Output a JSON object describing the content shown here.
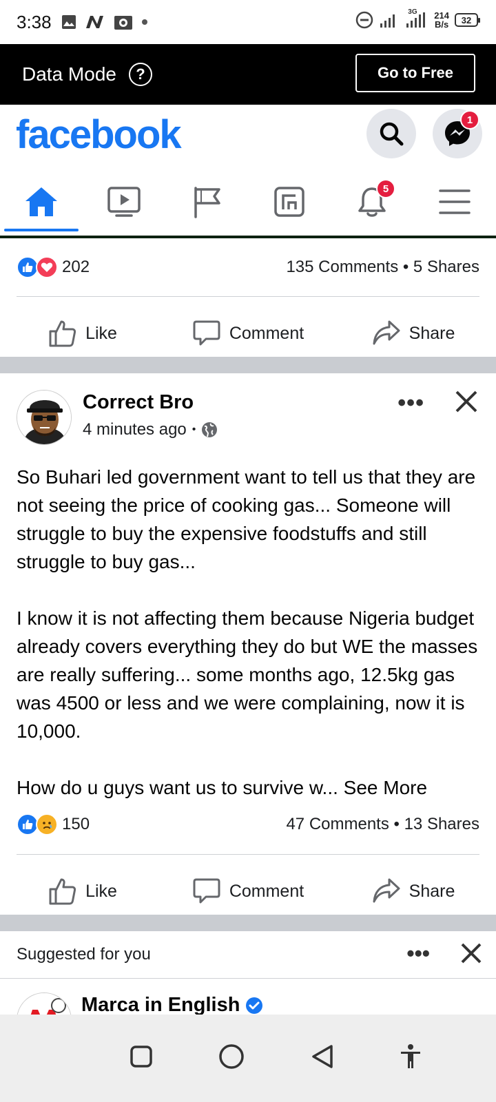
{
  "status_bar": {
    "time": "3:38",
    "network_type": "3G",
    "net_speed_value": "214",
    "net_speed_unit": "B/s",
    "battery": "32"
  },
  "data_mode": {
    "label": "Data Mode",
    "help": "?",
    "go_free_label": "Go to Free"
  },
  "header": {
    "logo": "facebook",
    "messenger_badge": "1"
  },
  "nav": {
    "notifications_badge": "5",
    "active_tab": "home"
  },
  "post1": {
    "reaction_count": "202",
    "comments_shares": "135 Comments • 5 Shares",
    "like_label": "Like",
    "comment_label": "Comment",
    "share_label": "Share"
  },
  "post2": {
    "author": "Correct Bro",
    "time": "4 minutes ago",
    "dot": "•",
    "paragraphs": [
      "So Buhari led government want to tell us that they are not seeing the price of cooking gas... Someone will struggle to buy the expensive foodstuffs and still struggle to buy gas...",
      "I know it is not affecting them because Nigeria budget already covers everything they do but WE the masses are really suffering... some months ago, 12.5kg gas was 4500 or less and we were complaining,  now it is 10,000."
    ],
    "last_line": "How do u guys want us to survive w... ",
    "see_more": "See More",
    "reaction_count": "150",
    "comments_shares": "47 Comments • 13 Shares",
    "like_label": "Like",
    "comment_label": "Comment",
    "share_label": "Share",
    "more": "•••"
  },
  "suggested": {
    "label": "Suggested for you",
    "more": "•••",
    "page_name": "Marca in English"
  },
  "colors": {
    "fb_blue": "#1877f2",
    "badge_red": "#e41e3f",
    "separator": "#c9ccd1"
  }
}
